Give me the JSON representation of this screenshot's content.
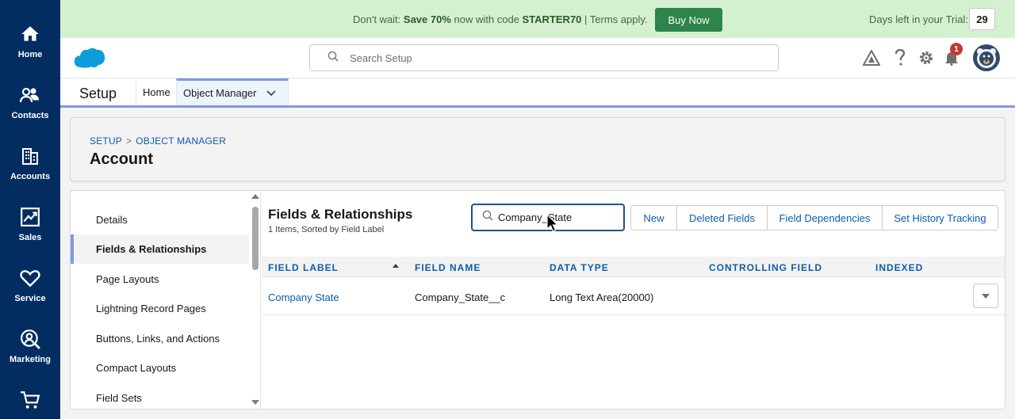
{
  "rail": {
    "items": [
      {
        "label": "Home",
        "icon": "home-icon"
      },
      {
        "label": "Contacts",
        "icon": "contacts-icon"
      },
      {
        "label": "Accounts",
        "icon": "accounts-icon"
      },
      {
        "label": "Sales",
        "icon": "sales-icon"
      },
      {
        "label": "Service",
        "icon": "service-icon"
      },
      {
        "label": "Marketing",
        "icon": "marketing-icon"
      },
      {
        "label": "",
        "icon": "cart-icon"
      }
    ]
  },
  "promo": {
    "lead": "Don't wait: ",
    "offer": "Save 70%",
    "middle": " now with code ",
    "code": "STARTER70",
    "tail": " | Terms apply.",
    "buy_label": "Buy Now",
    "trial_label": "Days left in your Trial:",
    "trial_days": "29"
  },
  "header": {
    "search_placeholder": "Search Setup",
    "notification_count": "1"
  },
  "context": {
    "app_title": "Setup",
    "tabs": [
      {
        "label": "Home"
      },
      {
        "label": "Object Manager"
      }
    ]
  },
  "page_header": {
    "crumb_1": "SETUP",
    "crumb_sep": ">",
    "crumb_2": "OBJECT MANAGER",
    "title": "Account"
  },
  "left_nav": {
    "items": [
      {
        "label": "Details"
      },
      {
        "label": "Fields & Relationships"
      },
      {
        "label": "Page Layouts"
      },
      {
        "label": "Lightning Record Pages"
      },
      {
        "label": "Buttons, Links, and Actions"
      },
      {
        "label": "Compact Layouts"
      },
      {
        "label": "Field Sets"
      }
    ]
  },
  "fields": {
    "title": "Fields & Relationships",
    "subtitle": "1 Items, Sorted by Field Label",
    "search_value": "Company_State",
    "buttons": [
      "New",
      "Deleted Fields",
      "Field Dependencies",
      "Set History Tracking"
    ],
    "columns": [
      "FIELD LABEL",
      "FIELD NAME",
      "DATA TYPE",
      "CONTROLLING FIELD",
      "INDEXED"
    ],
    "rows": [
      {
        "label": "Company State",
        "name": "Company_State__c",
        "type": "Long Text Area(20000)",
        "controlling": "",
        "indexed": ""
      }
    ]
  },
  "colors": {
    "rail": "#032d60",
    "promo_bg": "#d5f0d1",
    "buy_button": "#2e844a",
    "link": "#0b5cab",
    "accent": "#8298e3",
    "badge": "#c23934"
  }
}
